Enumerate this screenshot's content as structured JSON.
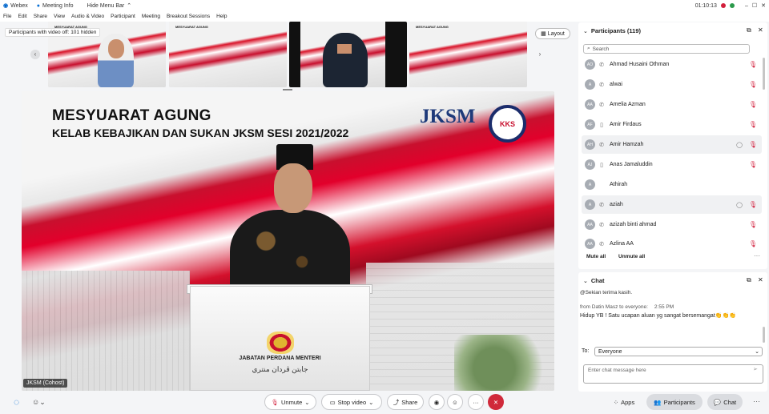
{
  "titlebar": {
    "app": "Webex",
    "meeting_info": "Meeting Info",
    "hide_menu": "Hide Menu Bar",
    "time": "01:10:13"
  },
  "menu": [
    "File",
    "Edit",
    "Share",
    "View",
    "Audio & Video",
    "Participant",
    "Meeting",
    "Breakout Sessions",
    "Help"
  ],
  "strip": {
    "hidden_notice": "Participants with video off: 101 hidden",
    "layout_label": "Layout",
    "thumb_title": "MESYUARAT AGUNG"
  },
  "stage": {
    "title1": "MESYUARAT AGUNG",
    "title2": "KELAB KEBAJIKAN DAN SUKAN JKSM SESI 2021/2022",
    "logo_jksm": "JKSM",
    "logo_kks": "KKS",
    "podium_text": "JABATAN PERDANA MENTERI",
    "podium_arabic": "جابتن ڤردان منتري",
    "speaker_label": "JKSM (Cohost)"
  },
  "participants": {
    "header": "Participants (119)",
    "search_placeholder": "Search",
    "list": [
      {
        "initials": "AO",
        "name": "Ahmad Husaini Othman",
        "status": "phone"
      },
      {
        "initials": "A",
        "name": "alwai",
        "status": "phone"
      },
      {
        "initials": "AA",
        "name": "Amelia Azman",
        "status": "phone"
      },
      {
        "initials": "AF",
        "name": "Amir Firdaus",
        "status": "mobile"
      },
      {
        "initials": "AH",
        "name": "Amir Hamzah",
        "status": "phone"
      },
      {
        "initials": "AJ",
        "name": "Anas Jamaluddin",
        "status": "mobile"
      },
      {
        "initials": "A",
        "name": "Athirah",
        "status": ""
      },
      {
        "initials": "A",
        "name": "aziah",
        "status": "phone"
      },
      {
        "initials": "AA",
        "name": "azizah binti ahmad",
        "status": "phone"
      },
      {
        "initials": "AA",
        "name": "Azlina AA",
        "status": "phone"
      }
    ],
    "mute_all": "Mute all",
    "unmute_all": "Unmute all"
  },
  "chat": {
    "header": "Chat",
    "msg0": "@Sekian terima kasih.",
    "sender": "from Datin Masz to everyone:",
    "time": "2:55 PM",
    "message": "Hidup YB ! Satu ucapan aluan yg sangat bersemangat👏👏👏",
    "to_label": "To:",
    "to_value": "Everyone",
    "input_placeholder": "Enter chat message here"
  },
  "controls": {
    "unmute": "Unmute",
    "stop_video": "Stop video",
    "share": "Share",
    "apps": "Apps",
    "participants": "Participants",
    "chat": "Chat"
  },
  "colors": {
    "end_call": "#d0293a",
    "mic_muted": "#d21f3c",
    "accent": "#0b72d6"
  }
}
